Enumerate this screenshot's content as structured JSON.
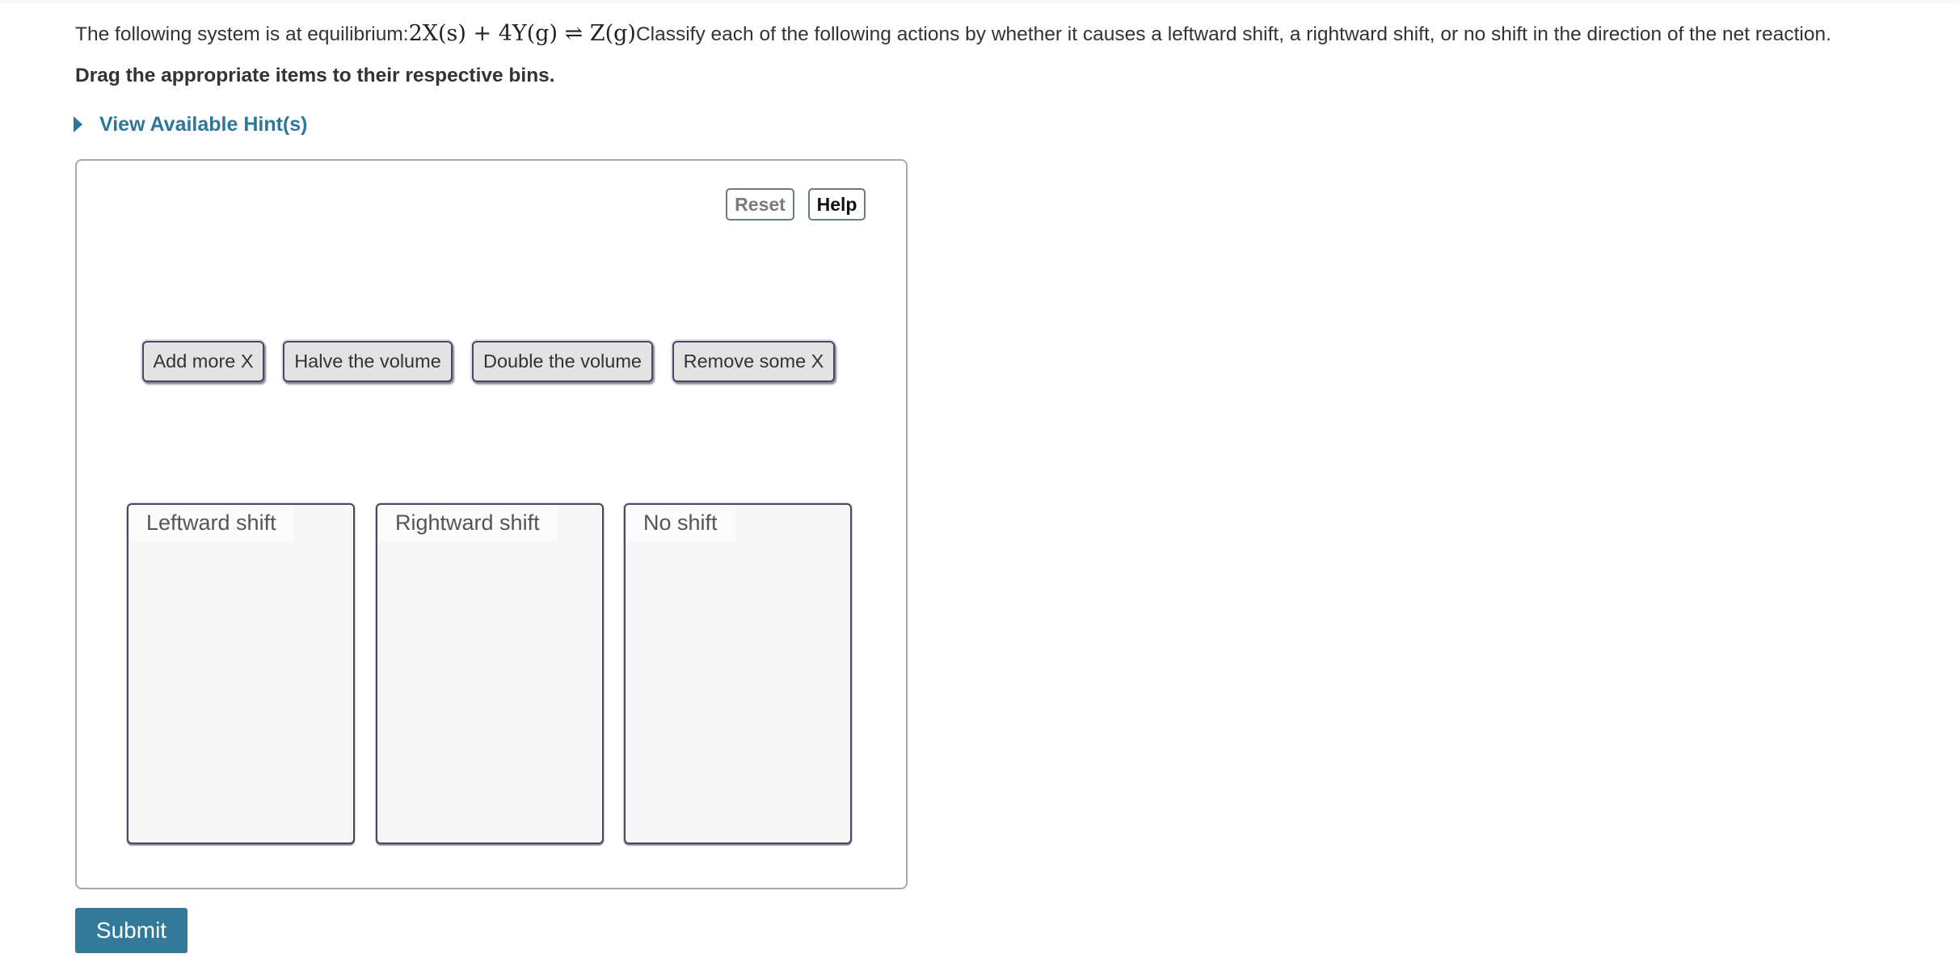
{
  "question": {
    "prefix": "The following system is at equilibrium:",
    "equation": "2X(s) + 4Y(g) ⇌ Z(g)",
    "suffix": "Classify each of the following actions by whether it causes a leftward shift, a rightward shift, or no shift in the direction of the net reaction."
  },
  "instruction": "Drag the appropriate items to their respective bins.",
  "hint": {
    "label": "View Available Hint(s)",
    "icon": "caret-right-icon"
  },
  "toolbar": {
    "reset_label": "Reset",
    "help_label": "Help"
  },
  "items": [
    {
      "label": "Add more X"
    },
    {
      "label": "Halve the volume"
    },
    {
      "label": "Double the volume"
    },
    {
      "label": "Remove some X"
    }
  ],
  "bins": [
    {
      "label": "Leftward shift"
    },
    {
      "label": "Rightward shift"
    },
    {
      "label": "No shift"
    }
  ],
  "submit_label": "Submit",
  "colors": {
    "accent": "#337999",
    "link": "#2f7698"
  }
}
